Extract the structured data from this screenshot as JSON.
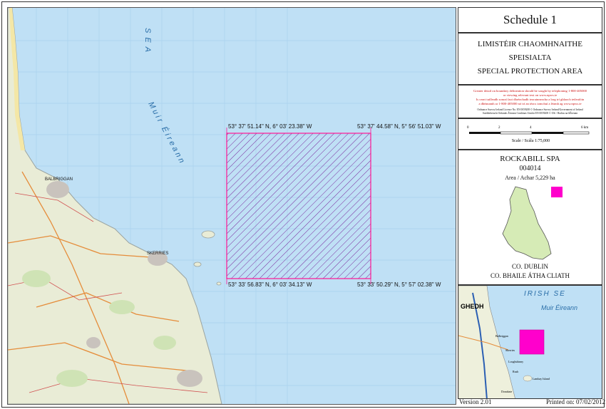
{
  "schedule_title": "Schedule 1",
  "designation": {
    "irish_line1": "LIMISTÉIR CHAOMHNAITHE",
    "irish_line2": "SPEISIALTA",
    "english": "SPECIAL PROTECTION AREA"
  },
  "notices": {
    "red_line1": "Greater detail on boundary delineation should be sought by telephoning 1-800-405000",
    "red_line2": "or viewing relevant text on www.npws.ie",
    "red_line3": "Is ceart tuilleadh sonraí faoi dhréachadh teorainneacha a lorg trí ghlaoch teileafóin",
    "red_line4": "a dhéanamh ar 1-800-405000 nó trí an téacs iomchuí a léamh ag www.npws.ie",
    "licence_line1": "Ordnance Survey Ireland Licence No. EN 0059208 © Ordnance Survey Ireland/Government of Ireland",
    "licence_line2": "Suirbhéireacht Ordanáis Éireann Ceadúnas Uimhir EN 0059208 © OSi / Rialtas na hÉireann"
  },
  "scale_bar": {
    "ticks": [
      "0",
      "2",
      "4",
      "6 km"
    ],
    "label": "Scale / Scála 1:75,000"
  },
  "site": {
    "name": "ROCKABILL SPA",
    "code": "004014",
    "area": "Area / Achar 5,229 ha",
    "county_en": "CO. DUBLIN",
    "county_ga": "CO. BHAILE ÁTHA CLIATH"
  },
  "corners": {
    "nw": "53° 37' 51.14\" N, 6° 03' 23.38\" W",
    "ne": "53° 37' 44.58\" N, 5° 56' 51.03\" W",
    "sw": "53° 33' 56.83\" N, 6° 03' 34.13\" W",
    "se": "53° 33' 50.29\" N, 5° 57' 02.38\" W"
  },
  "map_labels": {
    "sea_vertical": "SEA",
    "sea_irish": "Muir Éireann",
    "balbriggan": "BALBRIGGAN",
    "skerries": "SKERRIES"
  },
  "inset_labels": {
    "irish_sea": "IRISH SE",
    "muir": "Muir Éireann",
    "ghedh": "GHEDH",
    "balbriggan": "Balbriggan",
    "skerries": "Skerries",
    "loughshinny": "Loughshinny",
    "rush": "Rush",
    "lambay": "Lambay Island",
    "donabate": "Donabate"
  },
  "footer": {
    "version": "Version 2.01",
    "printed": "Printed on: 07/02/2012"
  },
  "colors": {
    "sea": "#bfe0f5",
    "land": "#eef0dc",
    "spa_fill": "#ff00cc",
    "hatch": "#7a2a9e"
  },
  "icons": {
    "county_outline": "county-dublin-outline-icon",
    "spa_marker": "spa-location-marker-icon"
  }
}
